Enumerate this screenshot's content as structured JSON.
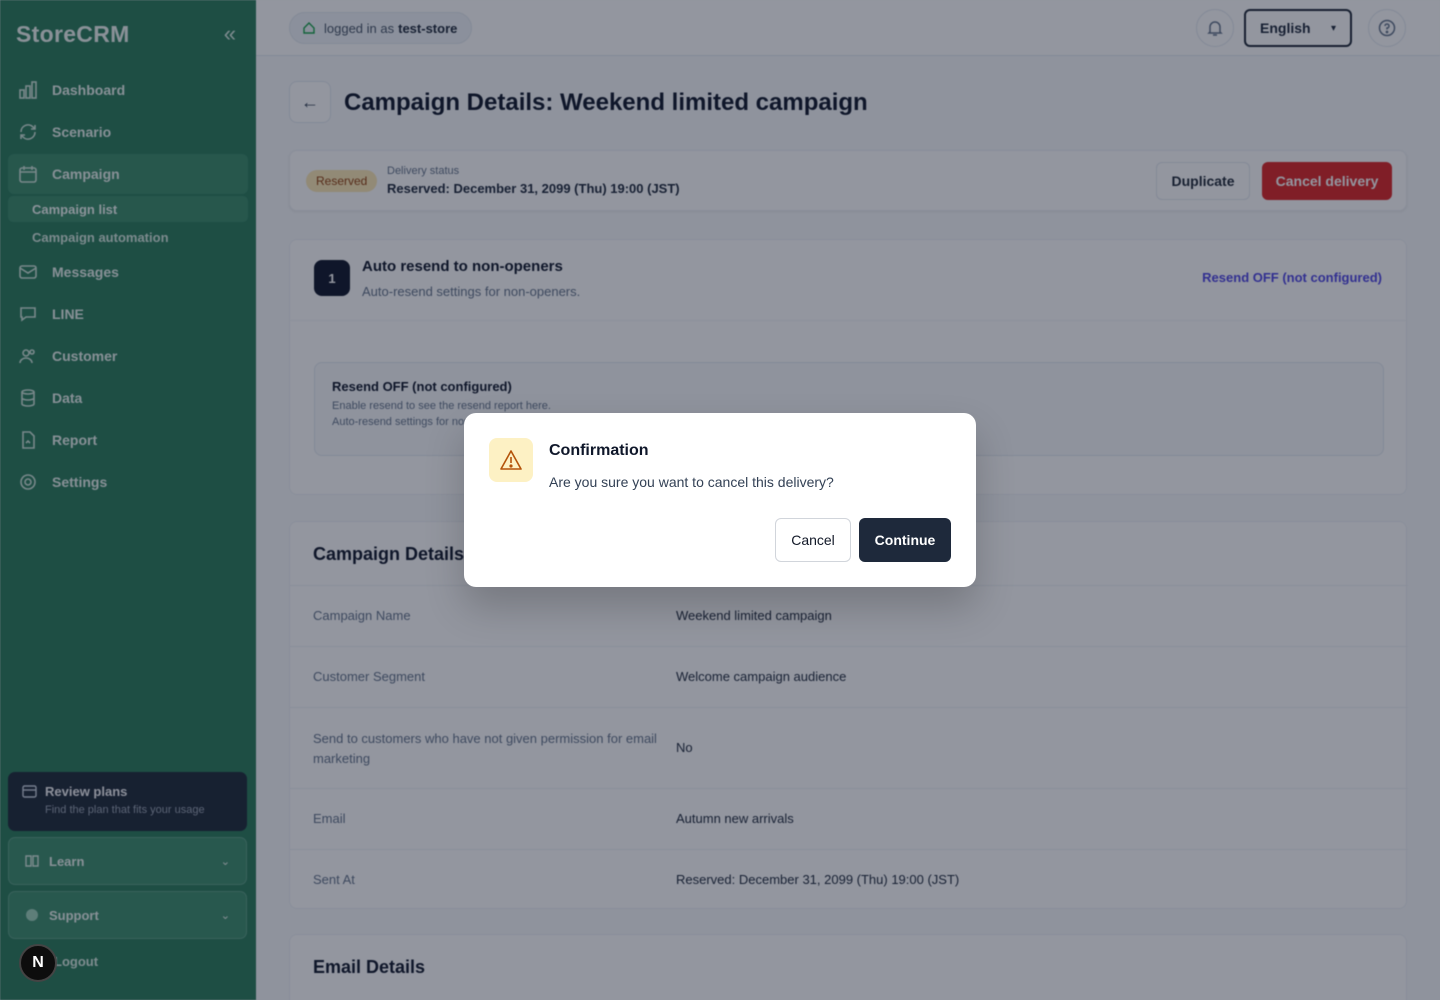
{
  "sidebar": {
    "logo": "StoreCRM",
    "collapse_icon": "«",
    "items": [
      {
        "label": "Dashboard",
        "icon": "bar-chart-icon"
      },
      {
        "label": "Scenario",
        "icon": "refresh-icon"
      },
      {
        "label": "Campaign",
        "icon": "calendar-icon",
        "active": true
      },
      {
        "label": "Messages",
        "icon": "mail-icon"
      },
      {
        "label": "LINE",
        "icon": "chat-icon"
      },
      {
        "label": "Customer",
        "icon": "users-icon"
      },
      {
        "label": "Data",
        "icon": "database-icon"
      },
      {
        "label": "Report",
        "icon": "file-icon"
      },
      {
        "label": "Settings",
        "icon": "gear-icon"
      }
    ],
    "sub_items": [
      {
        "label": "Campaign list",
        "active": true
      },
      {
        "label": "Campaign automation"
      }
    ],
    "plan_card": {
      "title": "Review plans",
      "subtitle": "Find the plan that fits your usage"
    },
    "learn": "Learn",
    "support": "Support",
    "logout": "Logout",
    "n_badge": "N"
  },
  "topbar": {
    "login_prefix": "logged in as",
    "login_user": "test-store",
    "language": "English"
  },
  "page": {
    "back_icon": "←",
    "title": "Campaign Details: Weekend limited campaign"
  },
  "status": {
    "badge": "Reserved",
    "label": "Delivery status",
    "value": "Reserved: December 31, 2099 (Thu) 19:00 (JST)",
    "duplicate": "Duplicate",
    "cancel_delivery": "Cancel delivery"
  },
  "resend": {
    "step": "1",
    "title": "Auto resend to non-openers",
    "subtitle": "Auto-resend settings for non-openers.",
    "link": "Resend OFF (not configured)",
    "box_title": "Resend OFF (not configured)",
    "box_line1": "Enable resend to see the resend report here.",
    "box_line2": "Auto-resend settings for non-openers."
  },
  "details": {
    "title": "Campaign Details",
    "rows": [
      {
        "label": "Campaign Name",
        "value": "Weekend limited campaign"
      },
      {
        "label": "Customer Segment",
        "value": "Welcome campaign audience"
      },
      {
        "label": "Send to customers who have not given permission for email marketing",
        "value": "No"
      },
      {
        "label": "Email",
        "value": "Autumn new arrivals"
      },
      {
        "label": "Sent At",
        "value": "Reserved: December 31, 2099 (Thu) 19:00 (JST)"
      }
    ]
  },
  "email_details": {
    "title": "Email Details"
  },
  "modal": {
    "icon": "warning-icon",
    "title": "Confirmation",
    "message": "Are you sure you want to cancel this delivery?",
    "cancel": "Cancel",
    "continue": "Continue"
  },
  "colors": {
    "sidebar": "#2a7c5a",
    "danger": "#dc2626",
    "primary_dark": "#1e293b",
    "link": "#4f46e5",
    "warning_bg": "#fdf1c4"
  }
}
